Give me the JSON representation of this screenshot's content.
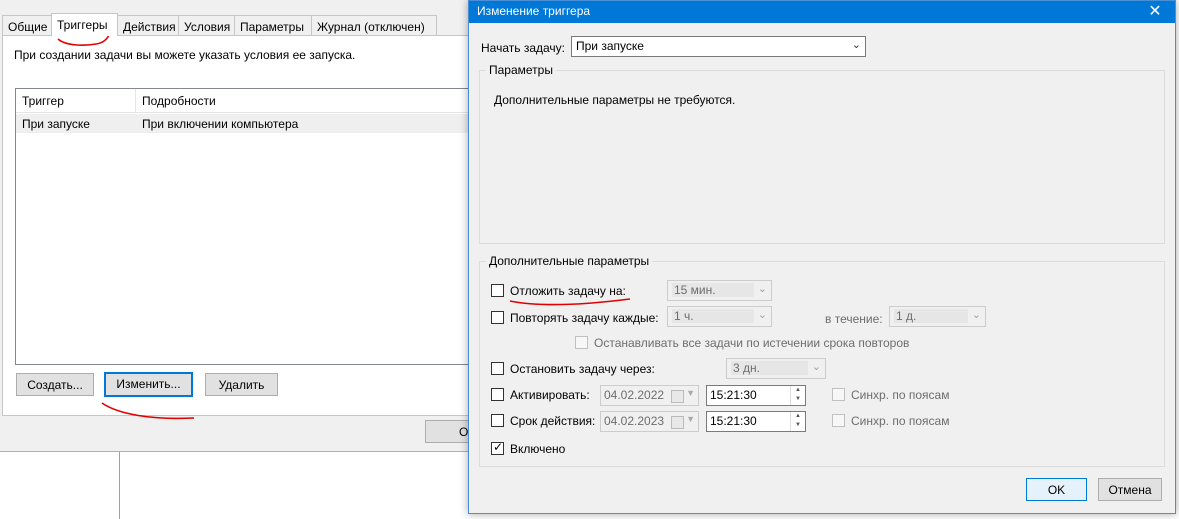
{
  "bg_dialog": {
    "tabs": [
      "Общие",
      "Триггеры",
      "Действия",
      "Условия",
      "Параметры",
      "Журнал (отключен)"
    ],
    "hint": "При создании задачи вы можете указать условия ее запуска.",
    "columns": [
      "Триггер",
      "Подробности"
    ],
    "rows": [
      {
        "trigger": "При запуске",
        "details": "При включении компьютера"
      }
    ],
    "buttons": {
      "create": "Создать...",
      "edit": "Изменить...",
      "delete": "Удалить"
    },
    "partial_button": "О"
  },
  "dialog": {
    "title": "Изменение триггера",
    "close_glyph": "✕",
    "begin_label": "Начать задачу:",
    "begin_value": "При запуске",
    "params_group": "Параметры",
    "params_text": "Дополнительные параметры не требуются.",
    "adv_group": "Дополнительные параметры",
    "delay": {
      "label": "Отложить задачу на:",
      "value": "15 мин.",
      "checked": false
    },
    "repeat": {
      "label": "Повторять задачу каждые:",
      "value": "1 ч.",
      "duration_label": "в течение:",
      "duration_value": "1 д.",
      "checked": false
    },
    "stop_all": {
      "label": "Останавливать все задачи по истечении срока повторов",
      "checked": false
    },
    "stop_after": {
      "label": "Остановить задачу через:",
      "value": "3 дн.",
      "checked": false
    },
    "activate": {
      "label": "Активировать:",
      "date": "04.02.2022",
      "time": "15:21:30",
      "sync_label": "Синхр. по поясам",
      "checked": false
    },
    "expire": {
      "label": "Срок действия:",
      "date": "04.02.2023",
      "time": "15:21:30",
      "sync_label": "Синхр. по поясам",
      "checked": false
    },
    "enabled": {
      "label": "Включено",
      "checked": true
    },
    "ok": "OK",
    "cancel": "Отмена"
  },
  "annotation_color": "#e00000"
}
